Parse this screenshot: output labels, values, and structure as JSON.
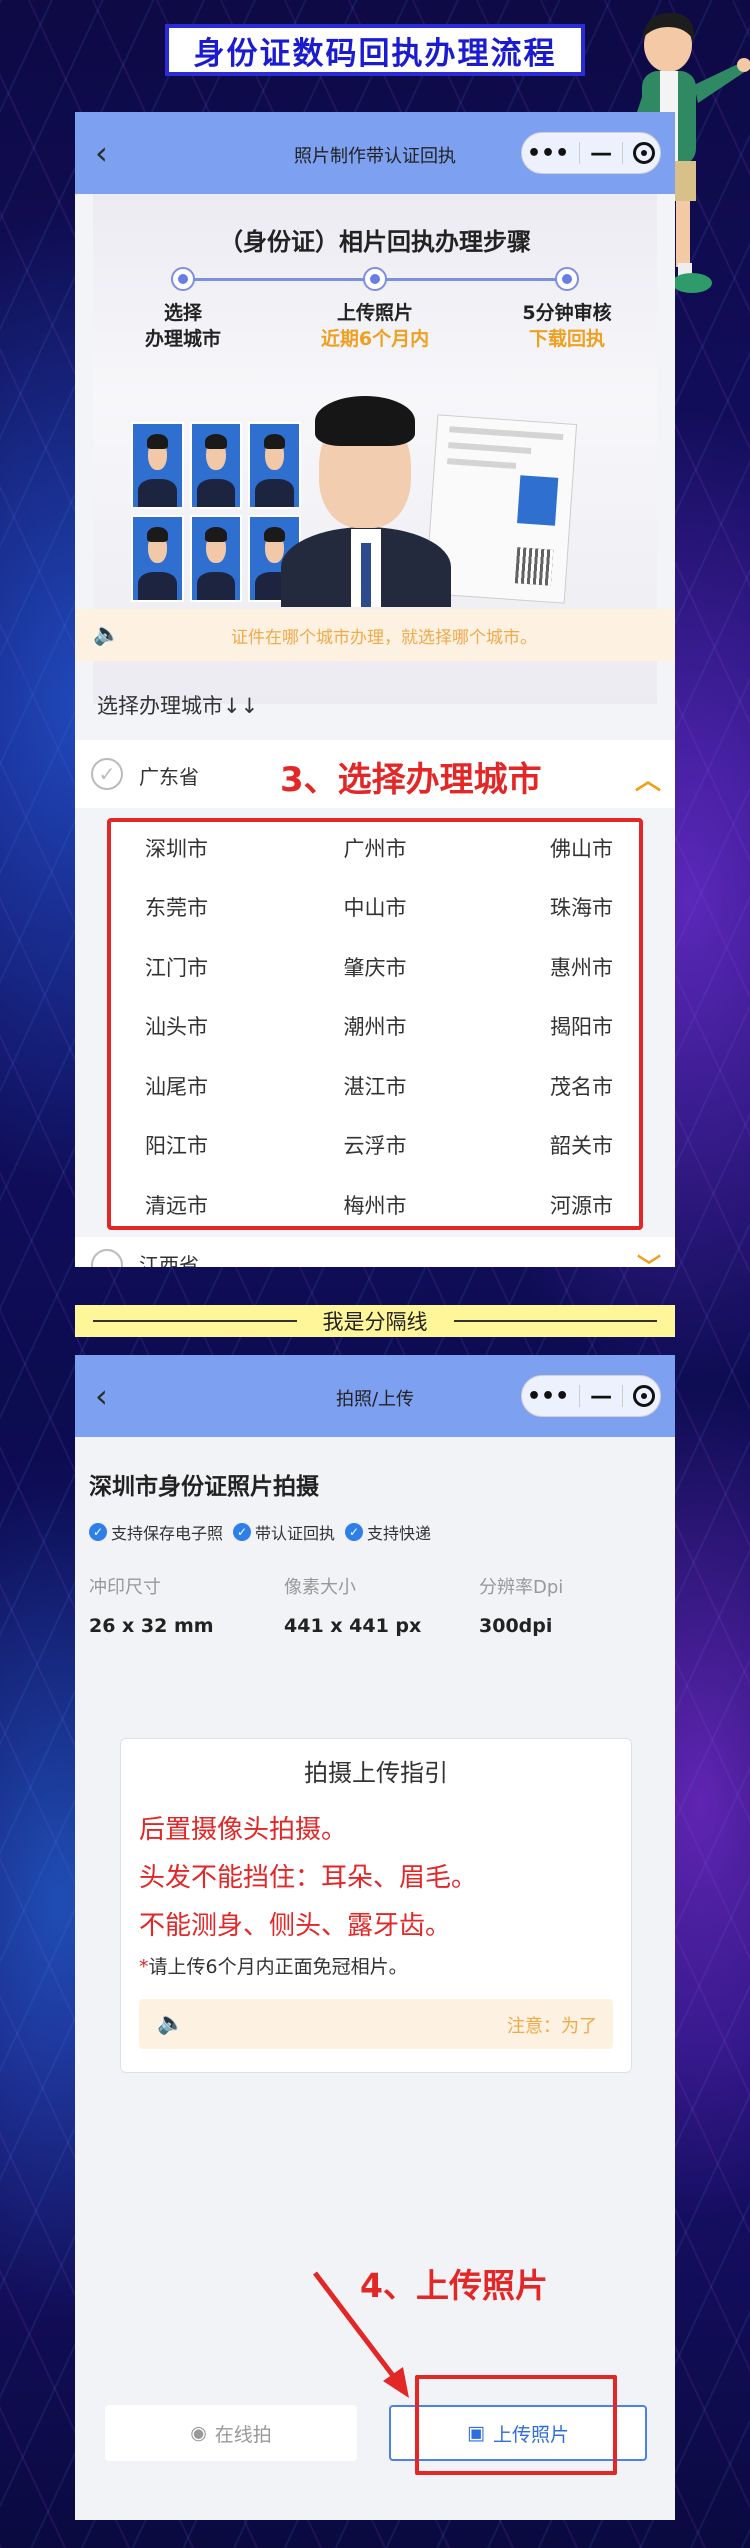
{
  "banner": {
    "title": "身份证数码回执办理流程"
  },
  "screen1": {
    "nav_title": "照片制作带认证回执",
    "back_glyph": "‹",
    "capsule_more": "•••",
    "capsule_min": "—",
    "steps": {
      "title": "（身份证）相片回执办理步骤",
      "items": [
        {
          "label": "选择",
          "sub": "办理城市"
        },
        {
          "label": "上传照片",
          "sub": "近期6个月内"
        },
        {
          "label": "5分钟审核",
          "sub": "下载回执"
        }
      ]
    },
    "notice": "证件在哪个城市办理，就选择哪个城市。",
    "select_title": "选择办理城市↓↓",
    "province": "广东省",
    "province_next": "江西省",
    "step_annotation": "3、选择办理城市",
    "cities": [
      "深圳市",
      "广州市",
      "佛山市",
      "东莞市",
      "中山市",
      "珠海市",
      "江门市",
      "肇庆市",
      "惠州市",
      "汕头市",
      "潮州市",
      "揭阳市",
      "汕尾市",
      "湛江市",
      "茂名市",
      "阳江市",
      "云浮市",
      "韶关市",
      "清远市",
      "梅州市",
      "河源市"
    ]
  },
  "divider": {
    "text": "我是分隔线"
  },
  "screen2": {
    "nav_title": "拍照/上传",
    "heading": "深圳市身份证照片拍摄",
    "badges": [
      "支持保存电子照",
      "带认证回执",
      "支持快递"
    ],
    "specs": [
      {
        "label": "冲印尺寸",
        "value": "26 x 32 mm"
      },
      {
        "label": "像素大小",
        "value": "441 x 441 px"
      },
      {
        "label": "分辨率Dpi",
        "value": "300dpi"
      }
    ],
    "guide": {
      "title": "拍摄上传指引",
      "lines": [
        "后置摄像头拍摄。",
        "头发不能挡住：耳朵、眉毛。",
        "不能测身、侧头、露牙齿。"
      ],
      "small_star": "*",
      "small": "请上传6个月内正面免冠相片。",
      "notice": "注意：为了"
    },
    "step_annotation": "4、上传照片",
    "btn_online": "在线拍",
    "btn_upload": "上传照片"
  },
  "colors": {
    "accent_blue": "#7da0f1",
    "annotation_red": "#e32626",
    "notice_orange": "#f0a94b"
  }
}
